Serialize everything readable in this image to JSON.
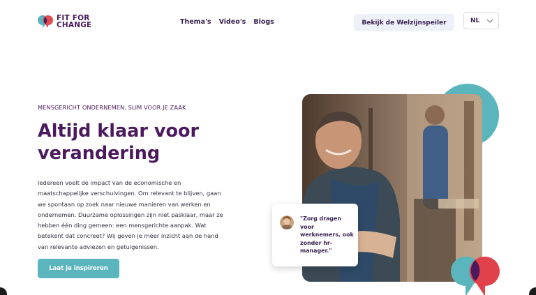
{
  "header": {
    "logo_line1": "FIT FOR",
    "logo_line2": "CHANGE",
    "nav": [
      "Thema's",
      "Video's",
      "Blogs"
    ],
    "cta_label": "Bekijk de Welzijnspeiler",
    "language": "NL"
  },
  "hero": {
    "eyebrow": "MENSGERICHT ONDERNEMEN, SLIM VOOR JE ZAAK",
    "title_line1": "Altijd klaar voor",
    "title_line2": "verandering",
    "body": "Iedereen voelt de impact van de economische en maatschappelijke verschuivingen. Om relevant te blijven, gaan we spontaan op zoek naar nieuwe manieren van werken en ondernemen. Duurzame oplossingen zijn niet pasklaar, maar ze hebben één ding gemeen: een mensgerichte aanpak. Wat betekent dat concreet? Wij geven je meer inzicht aan de hand van relevante adviezen en getuigenissen.",
    "cta_label": "Laat je inspireren"
  },
  "quote": {
    "text": "\"Zorg dragen voor werknemers, ook zonder hr-manager.\""
  },
  "colors": {
    "brand_purple": "#4a1a5c",
    "teal": "#5bb5bd",
    "red": "#e0414a",
    "button_light": "#eef2f8"
  },
  "icons": {
    "logo": "speech-bubbles-logo",
    "language_toggle": "chevron-down-icon",
    "decoration": "speech-bubbles-brand-mark"
  }
}
